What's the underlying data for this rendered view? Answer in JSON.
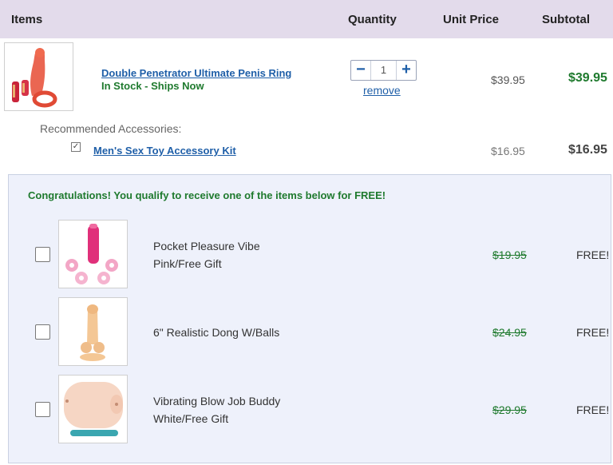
{
  "header": {
    "items": "Items",
    "quantity": "Quantity",
    "unit_price": "Unit Price",
    "subtotal": "Subtotal"
  },
  "cart_item": {
    "name": "Double Penetrator Ultimate Penis Ring",
    "stock": "In Stock - Ships Now",
    "quantity": "1",
    "minus": "−",
    "plus": "+",
    "remove": "remove",
    "unit_price": "$39.95",
    "subtotal": "$39.95"
  },
  "recommended": {
    "label": "Recommended Accessories:",
    "item_name": "Men's Sex Toy Accessory Kit",
    "checked_glyph": "✓",
    "unit_price": "$16.95",
    "subtotal": "$16.95"
  },
  "promo": {
    "title": "Congratulations! You qualify to receive one of the items below for FREE!",
    "gifts": [
      {
        "line1": "Pocket Pleasure Vibe",
        "line2": "Pink/Free Gift",
        "original_price": "$19.95",
        "price": "FREE!"
      },
      {
        "line1": "6\" Realistic Dong W/Balls",
        "line2": "",
        "original_price": "$24.95",
        "price": "FREE!"
      },
      {
        "line1": "Vibrating Blow Job Buddy",
        "line2": "White/Free Gift",
        "original_price": "$29.95",
        "price": "FREE!"
      }
    ]
  },
  "colors": {
    "header_bg": "#e3dbeb",
    "link": "#1f5fa8",
    "accent_green": "#1f7a2e",
    "promo_bg": "#eef1fb"
  }
}
